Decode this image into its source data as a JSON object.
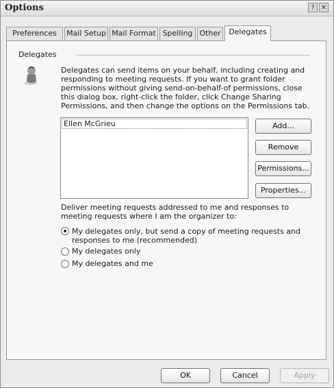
{
  "window": {
    "title": "Options",
    "help_glyph": "?",
    "close_glyph": "✕"
  },
  "tabs": [
    {
      "label": "Preferences",
      "active": false
    },
    {
      "label": "Mail Setup",
      "active": false
    },
    {
      "label": "Mail Format",
      "active": false
    },
    {
      "label": "Spelling",
      "active": false
    },
    {
      "label": "Other",
      "active": false
    },
    {
      "label": "Delegates",
      "active": true
    }
  ],
  "delegates": {
    "group_label": "Delegates",
    "description": "Delegates can send items on your behalf, including creating and responding to meeting requests. If you want to grant folder permissions without giving send-on-behalf-of permissions, close this dialog box, right-click the folder, click Change Sharing Permissions, and then change the options on the Permissions tab.",
    "list": [
      "Ellen McGrieu"
    ],
    "buttons": {
      "add": "Add...",
      "remove": "Remove",
      "permissions": "Permissions...",
      "properties": "Properties..."
    },
    "deliver_text": "Deliver meeting requests addressed to me and responses to meeting requests where I am the organizer to:",
    "options": [
      {
        "label_line1": "My delegates only, but send a copy of meeting requests and",
        "label_line2": "responses to me (recommended)",
        "selected": true
      },
      {
        "label": "My delegates only",
        "selected": false
      },
      {
        "label": "My delegates and me",
        "selected": false
      }
    ]
  },
  "footer": {
    "ok": "OK",
    "cancel": "Cancel",
    "apply": "Apply"
  },
  "colors": {
    "panel": "#f7f7f7",
    "window": "#ececec",
    "border": "#9a9a9a"
  }
}
